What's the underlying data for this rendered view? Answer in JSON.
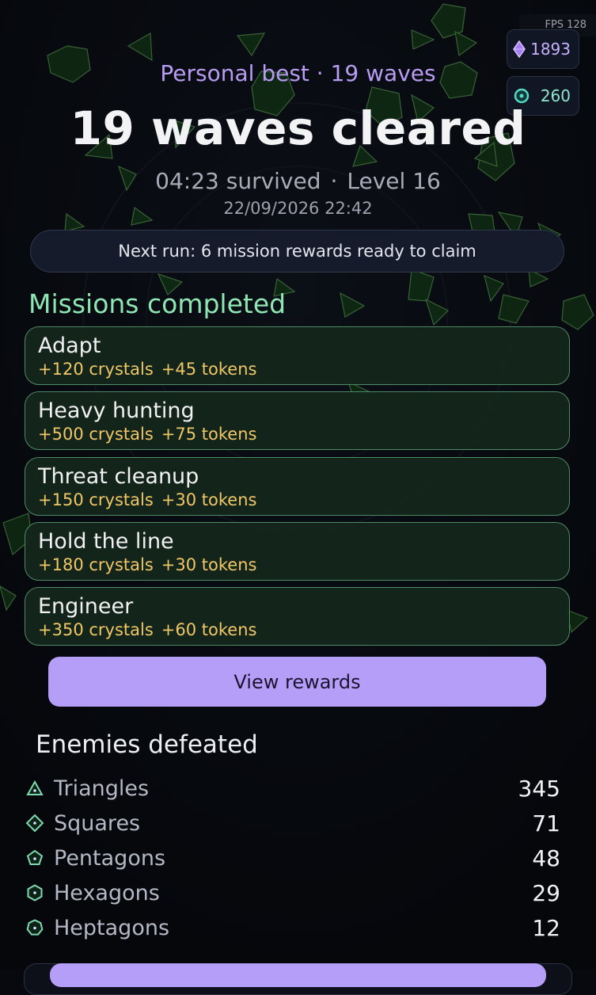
{
  "hud": {
    "fps": "FPS 128",
    "crystals": "1893",
    "tokens": "260",
    "crystal_icon": "diamond-icon",
    "token_icon": "coin-icon"
  },
  "summary": {
    "personal_best": "Personal best · 19 waves",
    "headline": "19 waves cleared",
    "survived": "04:23 survived",
    "separator": "·",
    "level": "Level 16",
    "datetime": "22/09/2026 22:42"
  },
  "next_run": "Next run:  6 mission rewards ready to claim",
  "missions": {
    "title": "Missions completed",
    "items": [
      {
        "name": "Adapt",
        "crystals": "+120 crystals",
        "tokens": "+45 tokens"
      },
      {
        "name": "Heavy hunting",
        "crystals": "+500 crystals",
        "tokens": "+75 tokens"
      },
      {
        "name": "Threat cleanup",
        "crystals": "+150 crystals",
        "tokens": "+30 tokens"
      },
      {
        "name": "Hold the line",
        "crystals": "+180 crystals",
        "tokens": "+30 tokens"
      },
      {
        "name": "Engineer",
        "crystals": "+350 crystals",
        "tokens": "+60 tokens"
      }
    ]
  },
  "view_rewards_label": "View rewards",
  "enemies": {
    "title": "Enemies defeated",
    "rows": [
      {
        "name": "Triangles",
        "count": "345",
        "icon": "triangle-icon"
      },
      {
        "name": "Squares",
        "count": "71",
        "icon": "square-icon"
      },
      {
        "name": "Pentagons",
        "count": "48",
        "icon": "pentagon-icon"
      },
      {
        "name": "Hexagons",
        "count": "29",
        "icon": "hexagon-icon"
      },
      {
        "name": "Heptagons",
        "count": "12",
        "icon": "heptagon-icon"
      }
    ]
  },
  "colors": {
    "accent_purple": "#b59ef8",
    "mission_green": "#8ee6b3",
    "reward_gold": "#f0c766",
    "background": "#07090f"
  }
}
